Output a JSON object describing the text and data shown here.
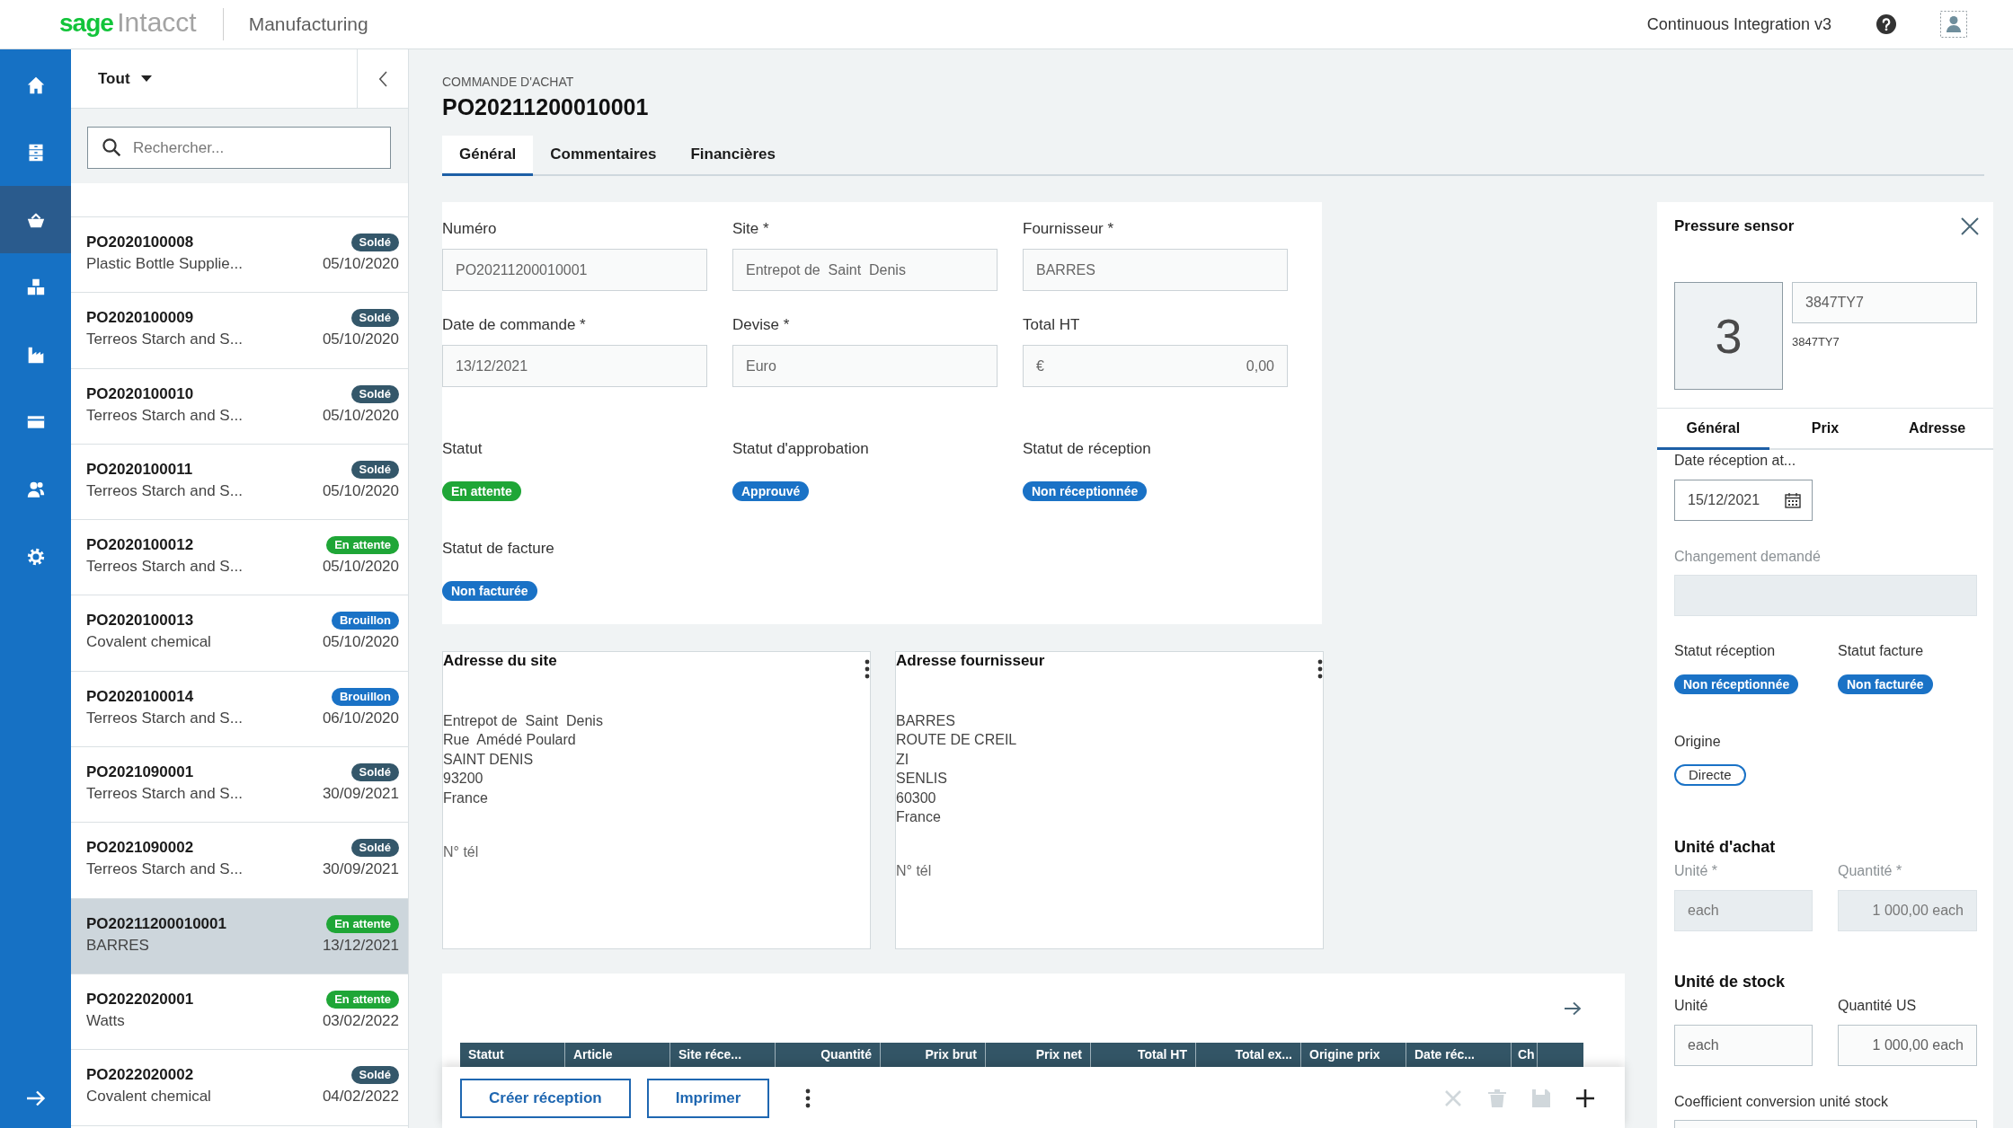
{
  "topbar": {
    "logo": {
      "brand": "sage",
      "product": "Intacct"
    },
    "module": "Manufacturing",
    "company": "Continuous Integration v3"
  },
  "nav": {
    "items": [
      {
        "selected": false
      },
      {
        "selected": false
      },
      {
        "selected": true
      },
      {
        "selected": false
      },
      {
        "selected": false
      },
      {
        "selected": false
      },
      {
        "selected": false
      },
      {
        "selected": false
      }
    ]
  },
  "list": {
    "filter": "Tout",
    "search": {
      "placeholder": "Rechercher..."
    },
    "items": [
      {
        "number": "PO2020100008",
        "supplier": "Plastic Bottle Supplie...",
        "status": {
          "text": "Soldé",
          "color": "#34576a"
        },
        "date": "05/10/2020",
        "selected": false
      },
      {
        "number": "PO2020100009",
        "supplier": "Terreos Starch and S...",
        "status": {
          "text": "Soldé",
          "color": "#34576a"
        },
        "date": "05/10/2020",
        "selected": false
      },
      {
        "number": "PO2020100010",
        "supplier": "Terreos Starch and S...",
        "status": {
          "text": "Soldé",
          "color": "#34576a"
        },
        "date": "05/10/2020",
        "selected": false
      },
      {
        "number": "PO2020100011",
        "supplier": "Terreos Starch and S...",
        "status": {
          "text": "Soldé",
          "color": "#34576a"
        },
        "date": "05/10/2020",
        "selected": false
      },
      {
        "number": "PO2020100012",
        "supplier": "Terreos Starch and S...",
        "status": {
          "text": "En attente",
          "color": "#1fa637"
        },
        "date": "05/10/2020",
        "selected": false
      },
      {
        "number": "PO2020100013",
        "supplier": "Covalent chemical",
        "status": {
          "text": "Brouillon",
          "color": "#1a72c6"
        },
        "date": "05/10/2020",
        "selected": false
      },
      {
        "number": "PO2020100014",
        "supplier": "Terreos Starch and S...",
        "status": {
          "text": "Brouillon",
          "color": "#1a72c6"
        },
        "date": "06/10/2020",
        "selected": false
      },
      {
        "number": "PO2021090001",
        "supplier": "Terreos Starch and S...",
        "status": {
          "text": "Soldé",
          "color": "#34576a"
        },
        "date": "30/09/2021",
        "selected": false
      },
      {
        "number": "PO2021090002",
        "supplier": "Terreos Starch and S...",
        "status": {
          "text": "Soldé",
          "color": "#34576a"
        },
        "date": "30/09/2021",
        "selected": false
      },
      {
        "number": "PO20211200010001",
        "supplier": "BARRES",
        "status": {
          "text": "En attente",
          "color": "#1fa637"
        },
        "date": "13/12/2021",
        "selected": true
      },
      {
        "number": "PO2022020001",
        "supplier": "Watts",
        "status": {
          "text": "En attente",
          "color": "#1fa637"
        },
        "date": "03/02/2022",
        "selected": false
      },
      {
        "number": "PO2022020002",
        "supplier": "Covalent chemical",
        "status": {
          "text": "Soldé",
          "color": "#34576a"
        },
        "date": "04/02/2022",
        "selected": false
      }
    ]
  },
  "document": {
    "type": "COMMANDE D'ACHAT",
    "number": "PO20211200010001",
    "tabs": [
      {
        "label": "Général",
        "selected": true
      },
      {
        "label": "Commentaires",
        "selected": false
      },
      {
        "label": "Financières",
        "selected": false
      }
    ],
    "fields": [
      {
        "label": "Numéro",
        "value": "PO20211200010001",
        "kind": "text"
      },
      {
        "label": "Site *",
        "value": "Entrepot de  Saint  Denis",
        "kind": "text"
      },
      {
        "label": "Fournisseur *",
        "value": "BARRES",
        "kind": "text"
      },
      {
        "label": "Date de commande *",
        "value": "13/12/2021",
        "kind": "text"
      },
      {
        "label": "Devise *",
        "value": "Euro",
        "kind": "text"
      },
      {
        "label": "Total HT",
        "prefix": "€",
        "value": "0,00",
        "kind": "currency"
      }
    ],
    "statuses": [
      {
        "label": "Statut",
        "badge": {
          "text": "En attente",
          "color": "#1fa637"
        }
      },
      {
        "label": "Statut d'approbation",
        "badge": {
          "text": "Approuvé",
          "color": "#1a72c6"
        }
      },
      {
        "label": "Statut de réception",
        "badge": {
          "text": "Non réceptionnée",
          "color": "#1a72c6"
        }
      },
      {
        "label": "Statut de facture",
        "badge": {
          "text": "Non facturée",
          "color": "#1a72c6"
        }
      }
    ],
    "addresses": [
      {
        "title": "Adresse du site",
        "lines": [
          "Entrepot de  Saint  Denis",
          "Rue  Amédé Poulard",
          "SAINT DENIS",
          "93200",
          "France"
        ],
        "phone_label": "N° tél"
      },
      {
        "title": "Adresse fournisseur",
        "lines": [
          "BARRES",
          "ROUTE DE CREIL",
          "ZI",
          "SENLIS",
          "60300",
          "France"
        ],
        "phone_label": "N° tél"
      }
    ],
    "lines": {
      "columns": [
        {
          "label": "Statut",
          "kind": "text"
        },
        {
          "label": "Article",
          "kind": "text"
        },
        {
          "label": "Site réce...",
          "kind": "text"
        },
        {
          "label": "Quantité",
          "kind": "number"
        },
        {
          "label": "Prix brut",
          "kind": "number"
        },
        {
          "label": "Prix net",
          "kind": "number"
        },
        {
          "label": "Total HT",
          "kind": "number"
        },
        {
          "label": "Total ex...",
          "kind": "number"
        },
        {
          "label": "Origine prix",
          "kind": "text"
        },
        {
          "label": "Date réc...",
          "kind": "text"
        },
        {
          "label": "Ch",
          "kind": "text"
        }
      ]
    },
    "actions": {
      "buttons": [
        "Créer réception",
        "Imprimer"
      ],
      "icons": [
        {
          "disabled": true
        },
        {
          "disabled": true
        },
        {
          "disabled": true
        },
        {
          "disabled": false
        }
      ]
    }
  },
  "detail_panel": {
    "title": "Pressure sensor",
    "thumbnail": "3",
    "code": "3847TY7",
    "code_caption": "3847TY7",
    "tabs": [
      {
        "label": "Général",
        "selected": true
      },
      {
        "label": "Prix",
        "selected": false
      },
      {
        "label": "Adresse",
        "selected": false
      }
    ],
    "receipt_date": {
      "label": "Date réception at...",
      "value": "15/12/2021"
    },
    "change_request": {
      "label": "Changement demandé",
      "disabled": true
    },
    "statuses": [
      {
        "label": "Statut réception",
        "badge": {
          "text": "Non réceptionnée",
          "color": "#1a72c6"
        }
      },
      {
        "label": "Statut facture",
        "badge": {
          "text": "Non facturée",
          "color": "#1a72c6"
        }
      }
    ],
    "origin": {
      "label": "Origine",
      "badge": {
        "text": "Directe",
        "color": "#1a72c6"
      }
    },
    "purchase_unit": {
      "title": "Unité d'achat",
      "fields": [
        {
          "label": "Unité *",
          "value": "each",
          "kind": "text",
          "disabled": true
        },
        {
          "label": "Quantité *",
          "value": "1 000,00 each",
          "kind": "quantity",
          "disabled": true
        }
      ]
    },
    "stock_unit": {
      "title": "Unité de stock",
      "fields": [
        {
          "label": "Unité",
          "value": "each",
          "kind": "text",
          "disabled": false
        },
        {
          "label": "Quantité US",
          "value": "1 000,00 each",
          "kind": "quantity",
          "disabled": false
        }
      ]
    },
    "conversion": {
      "label": "Coefficient conversion unité stock",
      "disabled": false
    }
  }
}
